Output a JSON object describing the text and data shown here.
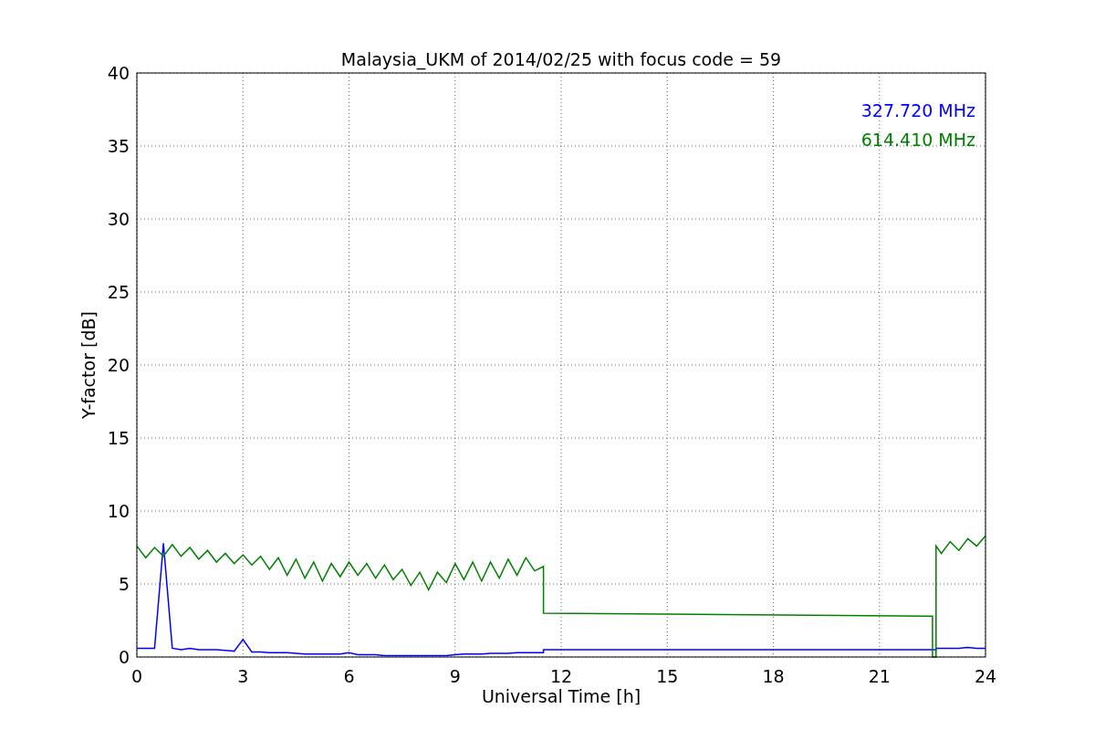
{
  "chart_data": {
    "type": "line",
    "title": "Malaysia_UKM of 2014/02/25 with focus code = 59",
    "xlabel": "Universal Time [h]",
    "ylabel": "Y-factor [dB]",
    "grid": true,
    "xlim": [
      0,
      24
    ],
    "ylim": [
      0,
      40
    ],
    "xticks": [
      0,
      3,
      6,
      9,
      12,
      15,
      18,
      21,
      24
    ],
    "yticks": [
      0,
      5,
      10,
      15,
      20,
      25,
      30,
      35,
      40
    ],
    "x": [
      0,
      0.25,
      0.5,
      0.75,
      1,
      1.25,
      1.5,
      1.75,
      2,
      2.25,
      2.5,
      2.75,
      3,
      3.25,
      3.5,
      3.75,
      4,
      4.25,
      4.5,
      4.75,
      5,
      5.25,
      5.5,
      5.75,
      6,
      6.25,
      6.5,
      6.75,
      7,
      7.25,
      7.5,
      7.75,
      8,
      8.25,
      8.5,
      8.75,
      9,
      9.25,
      9.5,
      9.75,
      10,
      10.25,
      10.5,
      10.75,
      11,
      11.25,
      11.5,
      11.5,
      22.5,
      22.5,
      22.6,
      22.6,
      22.75,
      23,
      23.25,
      23.5,
      23.75,
      24
    ],
    "series": [
      {
        "name": "327.720 MHz",
        "color": "#0000ff",
        "values": [
          0.6,
          0.6,
          0.6,
          7.8,
          0.6,
          0.5,
          0.6,
          0.5,
          0.5,
          0.5,
          0.45,
          0.4,
          1.2,
          0.35,
          0.35,
          0.3,
          0.3,
          0.3,
          0.25,
          0.2,
          0.2,
          0.2,
          0.2,
          0.2,
          0.3,
          0.15,
          0.15,
          0.15,
          0.1,
          0.1,
          0.1,
          0.1,
          0.1,
          0.1,
          0.1,
          0.1,
          0.15,
          0.2,
          0.2,
          0.2,
          0.25,
          0.25,
          0.25,
          0.3,
          0.3,
          0.3,
          0.3,
          0.5,
          0.5,
          0.5,
          0.5,
          0.6,
          0.6,
          0.6,
          0.6,
          0.65,
          0.6,
          0.6
        ]
      },
      {
        "name": "614.410 MHz",
        "color": "#008000",
        "values": [
          7.6,
          6.8,
          7.5,
          6.9,
          7.7,
          6.9,
          7.5,
          6.7,
          7.3,
          6.5,
          7.1,
          6.4,
          7.0,
          6.3,
          6.9,
          6.0,
          6.8,
          5.6,
          6.7,
          5.4,
          6.5,
          5.2,
          6.4,
          5.5,
          6.5,
          5.6,
          6.4,
          5.4,
          6.3,
          5.3,
          6.0,
          4.9,
          5.8,
          4.6,
          5.8,
          5.1,
          6.4,
          5.3,
          6.5,
          5.2,
          6.5,
          5.4,
          6.7,
          5.6,
          6.8,
          5.9,
          6.2,
          3.0,
          2.8,
          0.0,
          0.0,
          7.6,
          7.1,
          7.9,
          7.3,
          8.1,
          7.6,
          8.3
        ]
      }
    ]
  }
}
